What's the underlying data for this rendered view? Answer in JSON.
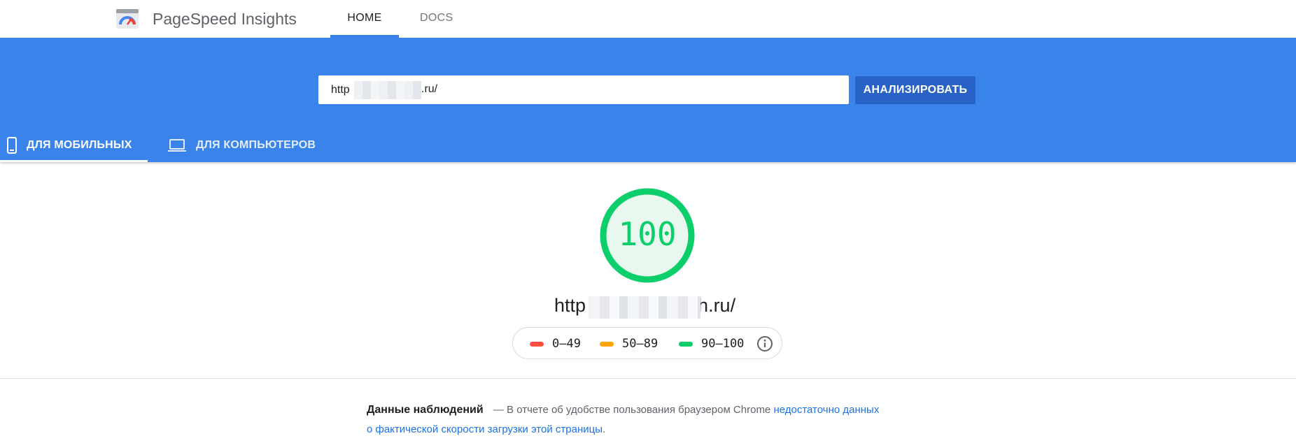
{
  "header": {
    "app_title": "PageSpeed Insights",
    "nav": [
      {
        "label": "HOME"
      },
      {
        "label": "DOCS"
      }
    ]
  },
  "search": {
    "url_value": "http",
    "url_tail": ".ru/",
    "analyze_label": "АНАЛИЗИРОВАТЬ"
  },
  "device_tabs": [
    {
      "label": "ДЛЯ МОБИЛЬНЫХ",
      "icon": "smartphone-icon",
      "active": true
    },
    {
      "label": "ДЛЯ КОМПЬЮТЕРОВ",
      "icon": "laptop-icon",
      "active": false
    }
  ],
  "result": {
    "score": "100",
    "score_fraction": 1.0,
    "url_prefix": "http",
    "url_suffix": "h.ru/"
  },
  "legend": [
    {
      "label": "0–49",
      "color": "#ff4e42"
    },
    {
      "label": "50–89",
      "color": "#ffa400"
    },
    {
      "label": "90–100",
      "color": "#0cce6b"
    }
  ],
  "field_data": {
    "title": "Данные наблюдений",
    "text": "— В отчете об удобстве пользования браузером Chrome",
    "link_text": "недостаточно данных о фактической скорости загрузки этой страницы",
    "tail": "."
  },
  "colors": {
    "brand_blue": "#3a83ea",
    "button_blue": "#2862c6",
    "pass_green": "#0cce6b",
    "link_blue": "#1a73e8"
  }
}
